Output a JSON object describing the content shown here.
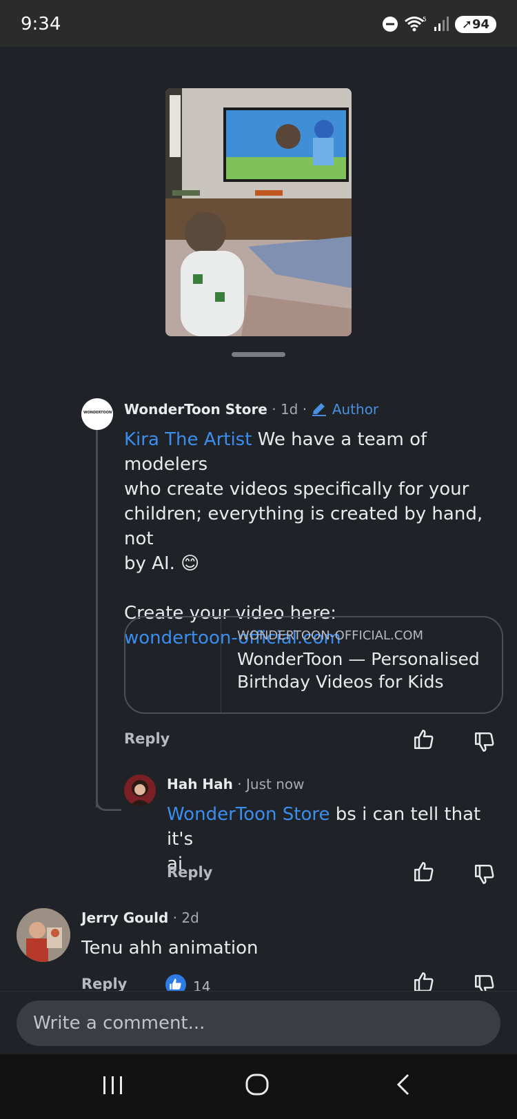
{
  "status": {
    "time": "9:34",
    "battery": "94"
  },
  "comments": [
    {
      "author": "WonderToon Store",
      "avatar_text": "WONDERTOON",
      "age": "· 1d ·",
      "badge": "Author",
      "mention": "Kira The Artist",
      "line1_rest": " We have a team of modelers",
      "line2": "who create videos specifically for your",
      "line3": "children; everything is created by hand, not",
      "line4": "by AI.",
      "emoji": "😊",
      "line5": "Create your video here:",
      "link": "wondertoon-official.com",
      "card": {
        "domain": "WONDERTOON-OFFICIAL.COM",
        "title": "WonderToon — Personalised Birthday Videos for Kids"
      },
      "reply_label": "Reply"
    },
    {
      "author": "Hah Hah",
      "age": "· Just now",
      "mention": "WonderToon Store",
      "text": " bs i can tell that it's",
      "text2": "ai",
      "reply_label": "Reply"
    },
    {
      "author": "Jerry Gould",
      "age": "· 2d",
      "text": "Tenu ahh animation",
      "reply_label": "Reply",
      "likes": "14"
    }
  ],
  "composer": {
    "placeholder": "Write a comment..."
  },
  "icons": {
    "like": "thumbs-up-icon",
    "dislike": "thumbs-down-icon",
    "author_badge": "pencil-icon",
    "nav_recents": "recents-icon",
    "nav_home": "home-icon",
    "nav_back": "back-icon"
  },
  "colors": {
    "link": "#3b8ef0",
    "background": "#1f2226"
  }
}
